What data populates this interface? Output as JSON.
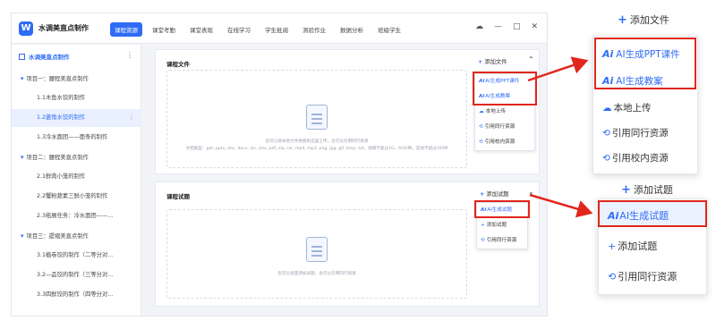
{
  "app": {
    "title": "水调美直点制作",
    "logo_letter": "W",
    "nav_tabs": [
      "课程资源",
      "课堂考勤",
      "课堂表现",
      "在线学习",
      "学生批阅",
      "测验作业",
      "数据分析",
      "班级学生"
    ],
    "active_tab_index": 0,
    "window_controls": {
      "cloud": "☁",
      "minimize": "—",
      "maximize": "□",
      "close": "✕"
    }
  },
  "sidebar": {
    "header_label": "水调美直点制作",
    "more_icon": "⋮",
    "items": [
      {
        "label": "项目一：腰程美直点制作",
        "type": "group"
      },
      {
        "label": "1.1木鱼水饺的制作",
        "type": "sub"
      },
      {
        "label": "1.2菱角水饺的制作",
        "type": "sub",
        "selected": true
      },
      {
        "label": "1.3冷水面团——面条的制作",
        "type": "sub"
      },
      {
        "label": "项目二：腰程美直点制作",
        "type": "group"
      },
      {
        "label": "2.1鲜肉小笼的制作",
        "type": "sub"
      },
      {
        "label": "2.2蟹粉蔬素三鲜小笼的制作",
        "type": "sub"
      },
      {
        "label": "2.3拓展任务：冷水面团——...",
        "type": "sub"
      },
      {
        "label": "项目三：提褶美直点制作",
        "type": "group"
      },
      {
        "label": "3.1植卷饺的制作（二等分对...",
        "type": "sub"
      },
      {
        "label": "3.2—品饺的制作（三等分对...",
        "type": "sub"
      },
      {
        "label": "3.3四鲜饺的制作（四等分对...",
        "type": "sub"
      }
    ]
  },
  "files_panel": {
    "title": "课程文件",
    "add_label": "添加文件",
    "chevron": "⌃",
    "hint_line1": "您可以将本地文件拖拽到这里上传，也可以引用同行资源",
    "hint_line2": "文档类型：ppt, pptx, doc, docx, xls, xlsx, pdf, zip, rar, mp4, mp3, png, jpg, gif, bmp, txt，视频不超过1G，60分钟，其他不超过100M",
    "menu": [
      "AI生成PPT课件",
      "AI生成教案",
      "本地上传",
      "引用同行资源",
      "引用校内资源"
    ]
  },
  "questions_panel": {
    "title": "课程试题",
    "add_label": "添加试题",
    "chevron": "⌄",
    "hint": "您可以批量添加试题，也可以引用同行资源",
    "menu": [
      "AI生成试题",
      "添加试题",
      "引用同行资源"
    ]
  },
  "callout_files": {
    "add_label": "添加文件",
    "items": [
      "AI生成PPT课件",
      "AI生成教案",
      "本地上传",
      "引用同行资源",
      "引用校内资源"
    ]
  },
  "callout_questions": {
    "add_label": "添加试题",
    "items": [
      "AI生成试题",
      "添加试题",
      "引用同行资源"
    ]
  },
  "ai_badge": "Ai",
  "colors": {
    "accent": "#2f6cf6",
    "highlight_red": "#e1261c"
  }
}
